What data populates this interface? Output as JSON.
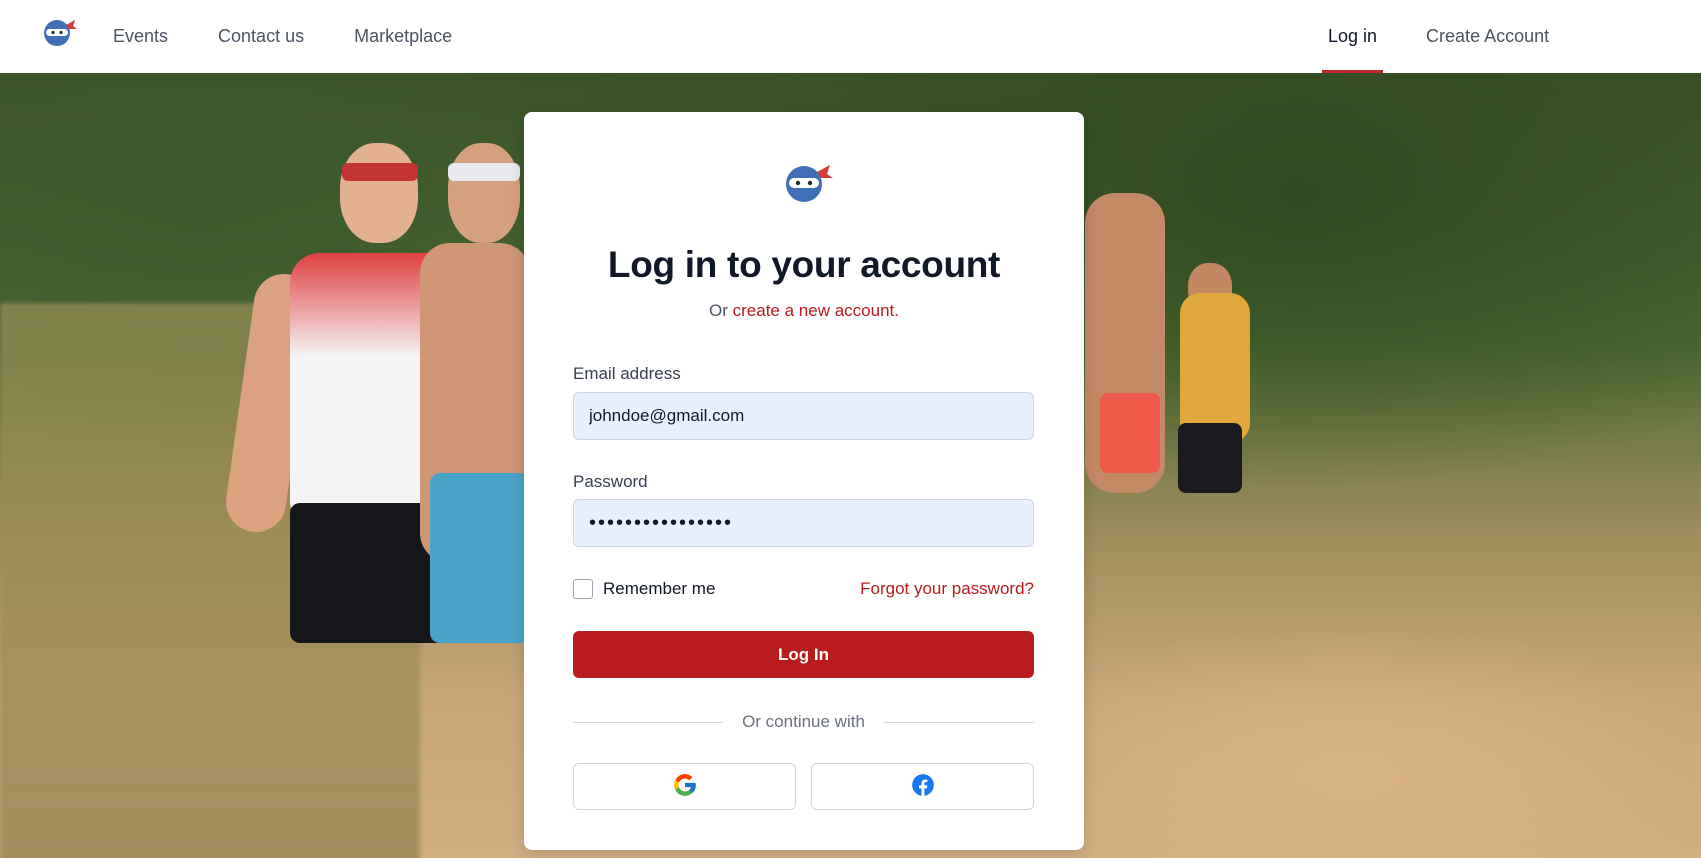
{
  "nav": {
    "logo_icon": "ninja-logo-icon",
    "links": [
      {
        "label": "Events"
      },
      {
        "label": "Contact us"
      },
      {
        "label": "Marketplace"
      }
    ],
    "login_label": "Log in",
    "create_account_label": "Create Account",
    "active_item": "Log in",
    "accent_color": "#c0272d"
  },
  "login_card": {
    "logo_icon": "ninja-logo-icon",
    "title": "Log in to your account",
    "subtitle_prefix": "Or",
    "subtitle_link": "create a new account.",
    "email": {
      "label": "Email address",
      "value": "johndoe@gmail.com"
    },
    "password": {
      "label": "Password",
      "value": "••••••••••••••••"
    },
    "remember_me": {
      "label": "Remember me",
      "checked": false
    },
    "forgot_password_label": "Forgot your password?",
    "submit_label": "Log In",
    "divider_text": "Or continue with",
    "social": [
      {
        "provider": "google",
        "icon": "google-icon"
      },
      {
        "provider": "facebook",
        "icon": "facebook-icon"
      }
    ],
    "primary_color": "#b91c1c",
    "input_bg_color": "#e8effd"
  },
  "background": {
    "description_icon": "runners-photo"
  }
}
